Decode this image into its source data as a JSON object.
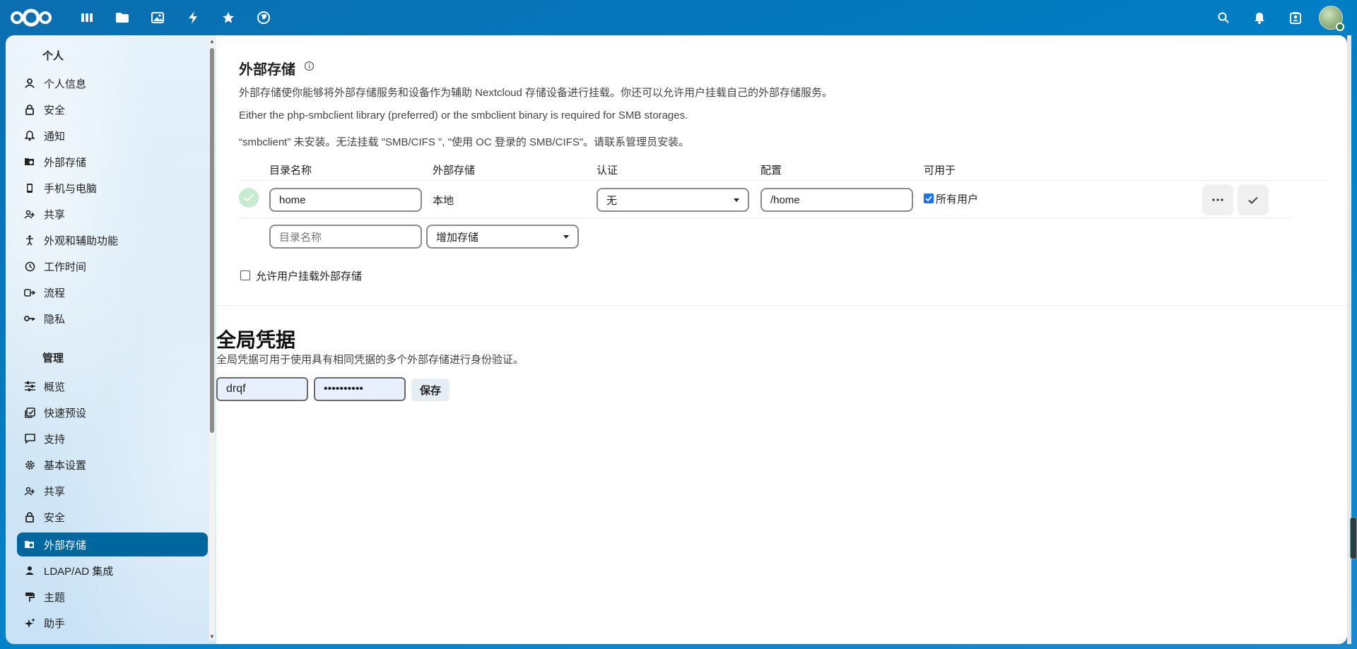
{
  "header": {
    "logo": "nextcloud-logo",
    "apps": [
      {
        "name": "dashboard-icon"
      },
      {
        "name": "files-icon"
      },
      {
        "name": "photos-icon"
      },
      {
        "name": "activity-icon"
      },
      {
        "name": "favorites-icon"
      },
      {
        "name": "globe-icon"
      }
    ],
    "right": [
      "search-icon",
      "bell-icon",
      "contacts-icon"
    ]
  },
  "sidebar": {
    "personal_title": "个人",
    "personal_items": [
      {
        "label": "个人信息",
        "icon": "user-icon"
      },
      {
        "label": "安全",
        "icon": "lock-icon"
      },
      {
        "label": "通知",
        "icon": "bell-icon"
      },
      {
        "label": "外部存储",
        "icon": "external-storage-icon"
      },
      {
        "label": "手机与电脑",
        "icon": "phone-icon"
      },
      {
        "label": "共享",
        "icon": "share-icon"
      },
      {
        "label": "外观和辅助功能",
        "icon": "accessibility-icon"
      },
      {
        "label": "工作时间",
        "icon": "clock-icon"
      },
      {
        "label": "流程",
        "icon": "flow-icon"
      },
      {
        "label": "隐私",
        "icon": "key-icon"
      }
    ],
    "admin_title": "管理",
    "admin_items": [
      {
        "label": "概览",
        "icon": "sliders-icon"
      },
      {
        "label": "快速预设",
        "icon": "presets-icon"
      },
      {
        "label": "支持",
        "icon": "support-icon"
      },
      {
        "label": "基本设置",
        "icon": "gear-icon"
      },
      {
        "label": "共享",
        "icon": "share-icon"
      },
      {
        "label": "安全",
        "icon": "lock-icon"
      },
      {
        "label": "外部存储",
        "icon": "external-storage-icon",
        "active": true
      },
      {
        "label": "LDAP/AD 集成",
        "icon": "user-icon"
      },
      {
        "label": "主题",
        "icon": "paint-icon"
      },
      {
        "label": "助手",
        "icon": "sparkle-icon"
      }
    ]
  },
  "external_storage": {
    "title": "外部存储",
    "desc1": "外部存储使你能够将外部存储服务和设备作为辅助 Nextcloud 存储设备进行挂载。你还可以允许用户挂载自己的外部存储服务。",
    "desc2": "Either the php-smbclient library (preferred) or the smbclient binary is required for SMB storages.",
    "desc3": "“smbclient” 未安装。无法挂载 \"SMB/CIFS \", \"使用 OC 登录的 SMB/CIFS\"。请联系管理员安装。",
    "columns": [
      "目录名称",
      "外部存储",
      "认证",
      "配置",
      "可用于"
    ],
    "row": {
      "folder": "home",
      "backend": "本地",
      "auth": "无",
      "config": "/home",
      "available_for": "所有用户"
    },
    "new_row": {
      "folder_placeholder": "目录名称",
      "add_storage": "增加存储"
    },
    "allow_users_label": "允许用户挂载外部存储"
  },
  "global_credentials": {
    "title": "全局凭据",
    "desc": "全局凭据可用于使用具有相同凭据的多个外部存储进行身份验证。",
    "username": "drqf",
    "password": "••••••••••",
    "save_label": "保存"
  },
  "colors": {
    "header_bg": "#0082c9",
    "active_item": "#00679e",
    "success": "#c7ebd0"
  }
}
